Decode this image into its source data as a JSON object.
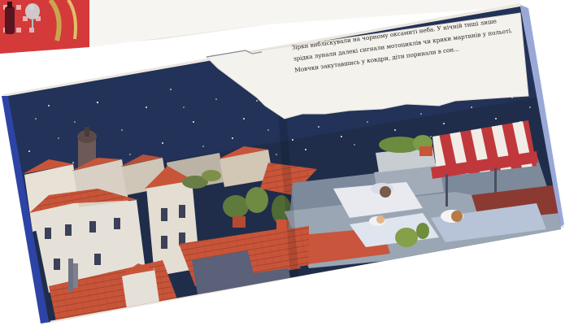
{
  "book": {
    "text_lines": [
      "Зірки вибліскували на чорному оксамиті неба. У нічній тиші лише",
      "зрідка лунали далекі сигнали мотоциклів чи крики мартинів у польоті.",
      "Мовчки закутавшись у ковдри, діти поринали в сон..."
    ]
  },
  "colors": {
    "night_sky": "#1f2d4a",
    "roof_orange": "#c8553a",
    "awning_red": "#c0383c",
    "page_white": "#f4f2ec",
    "cover_blue": "#2e43a6"
  }
}
